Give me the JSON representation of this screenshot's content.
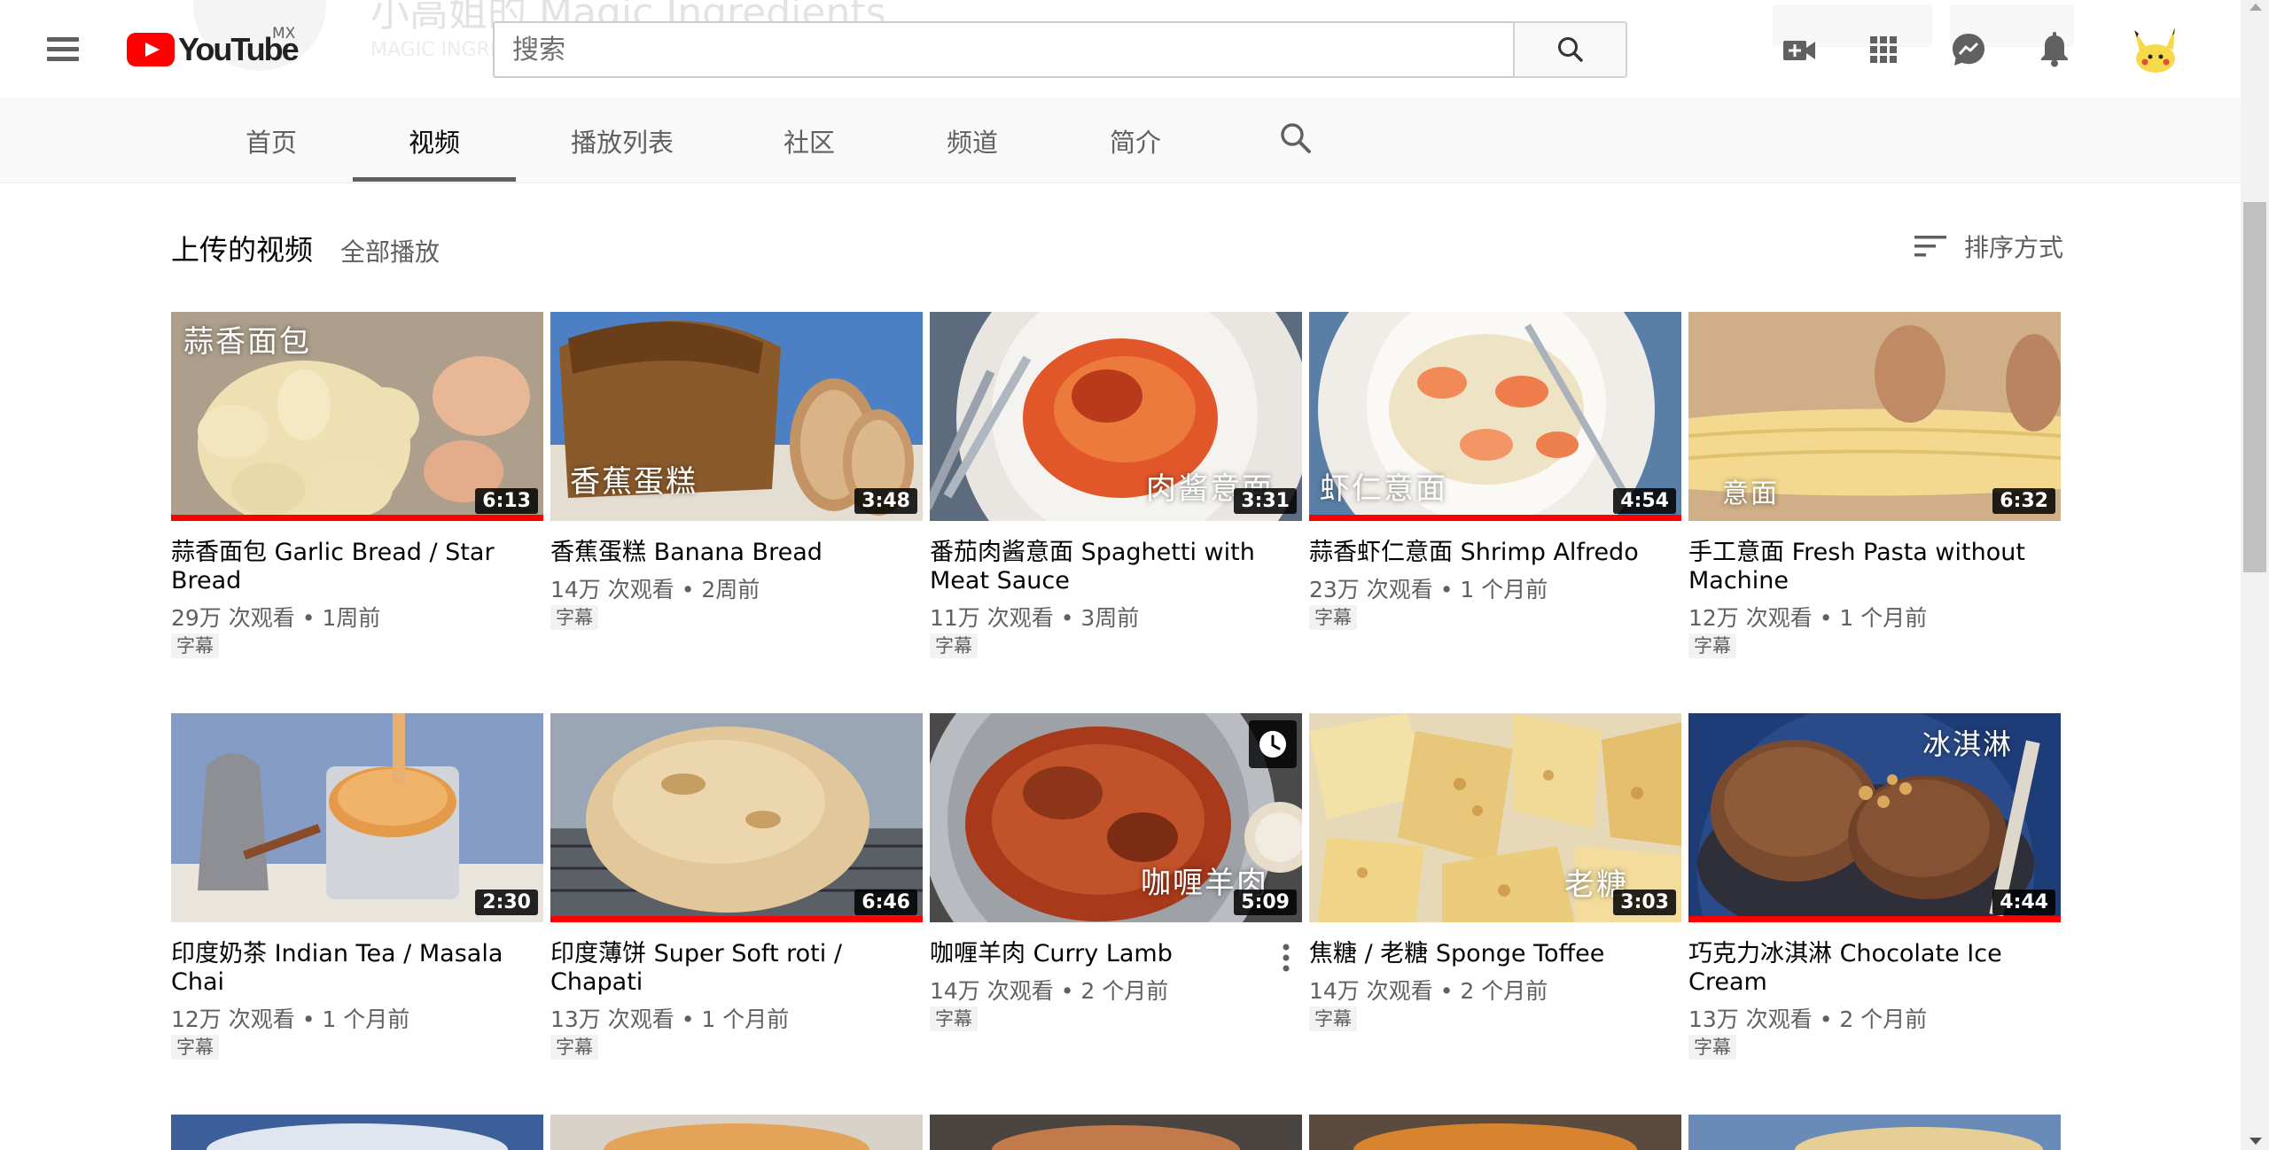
{
  "masthead": {
    "logo_text": "YouTube",
    "country_code": "MX",
    "search_placeholder": "搜索",
    "faded_channel_name": "小高姐的 Magic Ingredients",
    "faded_channel_sub": "MAGIC INGREDIENTS"
  },
  "tabs": [
    {
      "label": "首页",
      "active": false
    },
    {
      "label": "视频",
      "active": true
    },
    {
      "label": "播放列表",
      "active": false
    },
    {
      "label": "社区",
      "active": false
    },
    {
      "label": "频道",
      "active": false
    },
    {
      "label": "简介",
      "active": false
    }
  ],
  "section": {
    "title": "上传的视频",
    "play_all": "全部播放",
    "sort_label": "排序方式"
  },
  "cc_label": "字幕",
  "videos": [
    {
      "title": "蒜香面包 Garlic Bread / Star Bread",
      "views": "29万 次观看",
      "age": "1周前",
      "duration": "6:13",
      "overlay": "蒜香面包",
      "progress": 1.0
    },
    {
      "title": "香蕉蛋糕 Banana Bread",
      "views": "14万 次观看",
      "age": "2周前",
      "duration": "3:48",
      "overlay": "香蕉蛋糕",
      "progress": 0
    },
    {
      "title": "番茄肉酱意面 Spaghetti with Meat Sauce",
      "views": "11万 次观看",
      "age": "3周前",
      "duration": "3:31",
      "overlay": "肉酱意面",
      "progress": 0
    },
    {
      "title": "蒜香虾仁意面 Shrimp Alfredo",
      "views": "23万 次观看",
      "age": "1 个月前",
      "duration": "4:54",
      "overlay": "虾仁意面",
      "progress": 1.0
    },
    {
      "title": "手工意面 Fresh Pasta without Machine",
      "views": "12万 次观看",
      "age": "1 个月前",
      "duration": "6:32",
      "overlay": "意面",
      "progress": 0
    },
    {
      "title": "印度奶茶 Indian Tea / Masala Chai",
      "views": "12万 次观看",
      "age": "1 个月前",
      "duration": "2:30",
      "overlay": "",
      "progress": 0
    },
    {
      "title": "印度薄饼 Super Soft roti / Chapati",
      "views": "13万 次观看",
      "age": "1 个月前",
      "duration": "6:46",
      "overlay": "",
      "progress": 1.0
    },
    {
      "title": "咖喱羊肉 Curry Lamb",
      "views": "14万 次观看",
      "age": "2 个月前",
      "duration": "5:09",
      "overlay": "咖喱羊肉",
      "progress": 0
    },
    {
      "title": "焦糖 / 老糖 Sponge Toffee",
      "views": "14万 次观看",
      "age": "2 个月前",
      "duration": "3:03",
      "overlay": "老糖",
      "progress": 0
    },
    {
      "title": "巧克力冰淇淋 Chocolate Ice Cream",
      "views": "13万 次观看",
      "age": "2 个月前",
      "duration": "4:44",
      "overlay": "冰淇淋",
      "progress": 1.0
    }
  ],
  "colors": {
    "brand_red": "#ff0000",
    "text_primary": "#030303",
    "text_secondary": "#606060",
    "tab_bar_bg": "#f9f9f9"
  },
  "icons": [
    "menu-icon",
    "youtube-logo-icon",
    "search-icon",
    "create-video-icon",
    "apps-grid-icon",
    "messages-icon",
    "notifications-bell-icon",
    "channel-search-icon",
    "sort-icon",
    "watch-later-icon",
    "more-vert-icon"
  ]
}
